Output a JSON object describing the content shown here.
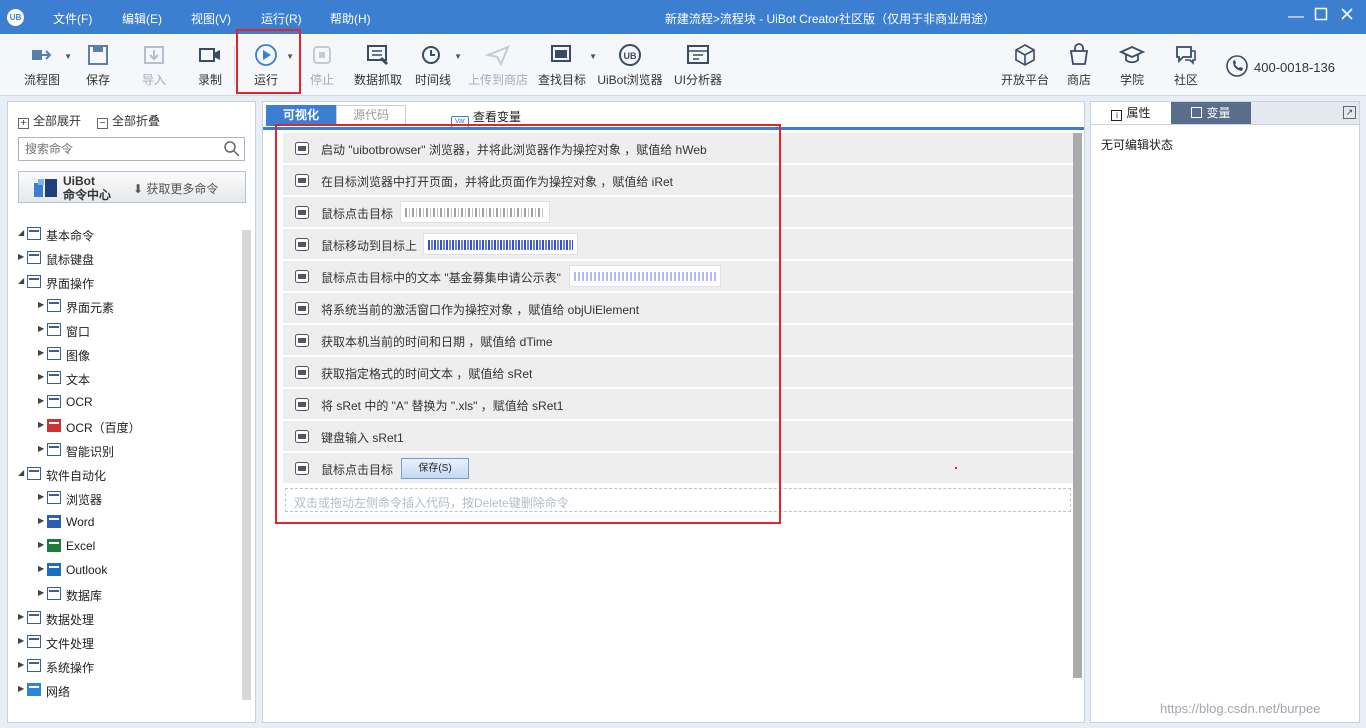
{
  "titlebar": {
    "logo": "UB",
    "menus": [
      "文件(F)",
      "编辑(E)",
      "视图(V)",
      "运行(R)",
      "帮助(H)"
    ],
    "title": "新建流程>流程块 - UiBot Creator社区版（仅用于非商业用途）"
  },
  "toolbar": {
    "flowchart": "流程图",
    "save": "保存",
    "import": "导入",
    "record": "录制",
    "run": "运行",
    "stop": "停止",
    "data_capture": "数据抓取",
    "timeline": "时间线",
    "upload": "上传到商店",
    "find_target": "查找目标",
    "browser": "UiBot浏览器",
    "ui_analyzer": "UI分析器",
    "open_platform": "开放平台",
    "store": "商店",
    "academy": "学院",
    "community": "社区",
    "phone": "400-0018-136"
  },
  "left": {
    "expand_all": "全部展开",
    "collapse_all": "全部折叠",
    "search_placeholder": "搜索命令",
    "cmd_center_line1": "UiBot",
    "cmd_center_line2": "命令中心",
    "get_more": "获取更多命令",
    "tree": [
      {
        "label": "基本命令",
        "icon": "basic-command-icon"
      },
      {
        "label": "鼠标键盘",
        "icon": "mouse-keyboard-icon"
      },
      {
        "label": "界面操作",
        "icon": "ui-operation-icon"
      },
      {
        "label": "界面元素",
        "icon": "ui-element-icon"
      },
      {
        "label": "窗口",
        "icon": "window-icon"
      },
      {
        "label": "图像",
        "icon": "image-icon"
      },
      {
        "label": "文本",
        "icon": "text-icon"
      },
      {
        "label": "OCR",
        "icon": "ocr-icon"
      },
      {
        "label": "OCR（百度）",
        "icon": "baidu-ocr-icon"
      },
      {
        "label": "智能识别",
        "icon": "smart-recognition-icon"
      },
      {
        "label": "软件自动化",
        "icon": "software-automation-icon"
      },
      {
        "label": "浏览器",
        "icon": "browser-icon"
      },
      {
        "label": "Word",
        "icon": "word-icon"
      },
      {
        "label": "Excel",
        "icon": "excel-icon"
      },
      {
        "label": "Outlook",
        "icon": "outlook-icon"
      },
      {
        "label": "数据库",
        "icon": "database-icon"
      },
      {
        "label": "数据处理",
        "icon": "data-processing-icon"
      },
      {
        "label": "文件处理",
        "icon": "file-processing-icon"
      },
      {
        "label": "系统操作",
        "icon": "system-operation-icon"
      },
      {
        "label": "网络",
        "icon": "network-icon"
      }
    ]
  },
  "editor": {
    "tab_visual": "可视化",
    "tab_source": "源代码",
    "view_vars": "查看变量",
    "view_vars_icon": "Var",
    "rows": [
      {
        "text": "启动 \"uibotbrowser\" 浏览器，并将此浏览器作为操控对象 ，赋值给 hWeb",
        "icon": "browser-launch-icon"
      },
      {
        "text": "在目标浏览器中打开页面，并将此页面作为操控对象 ，赋值给 iRet",
        "icon": "browser-open-icon"
      },
      {
        "text": "鼠标点击目标",
        "icon": "target-click-icon"
      },
      {
        "text": "鼠标移动到目标上",
        "icon": "target-hover-icon"
      },
      {
        "text": "鼠标点击目标中的文本 \"基金募集申请公示表\"",
        "icon": "text-click-icon"
      },
      {
        "text": "将系统当前的激活窗口作为操控对象 ，赋值给 objUiElement",
        "icon": "window-command-icon"
      },
      {
        "text": "获取本机当前的时间和日期 ，赋值给 dTime",
        "icon": "calendar-icon"
      },
      {
        "text": "获取指定格式的时间文本 ，赋值给 sRet",
        "icon": "calendar-icon"
      },
      {
        "text": "将 sRet 中的 \"A\" 替换为 \".xls\" ，赋值给 sRet1",
        "icon": "replace-text-icon"
      },
      {
        "text": "键盘输入 sRet1",
        "icon": "keyboard-icon"
      },
      {
        "text": "鼠标点击目标",
        "icon": "target-click-icon"
      }
    ],
    "save_btn": "保存(S)",
    "dropzone": "双击或拖动左侧命令插入代码，按Delete键删除命令"
  },
  "right": {
    "tab_props": "属性",
    "tab_vars": "变量",
    "noedit": "无可编辑状态"
  },
  "watermark": "https://blog.csdn.net/burpee"
}
